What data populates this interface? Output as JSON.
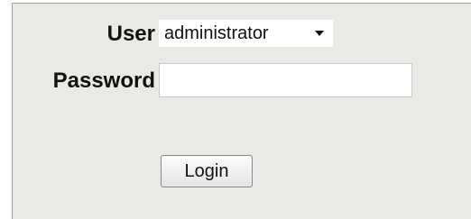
{
  "form": {
    "user_label": "User",
    "user_selected": "administrator",
    "password_label": "Password",
    "password_value": "",
    "login_label": "Login"
  },
  "icons": {
    "user_dropdown": "chevron-down-icon"
  }
}
